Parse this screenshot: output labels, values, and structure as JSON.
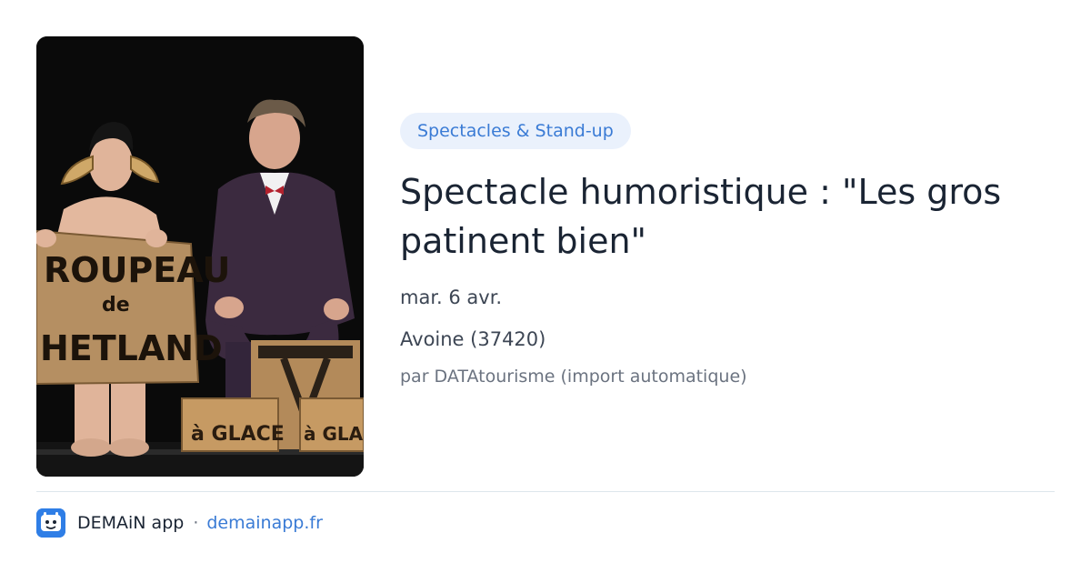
{
  "event": {
    "category": "Spectacles & Stand-up",
    "title": "Spectacle humoristique : \"Les gros patinent bien\"",
    "date": "mar. 6 avr.",
    "location": "Avoine (37420)",
    "source": "par DATAtourisme (import automatique)"
  },
  "image": {
    "sign_line1": "ROUPEAU",
    "sign_line2": "de",
    "sign_line3": "HETLAND",
    "box_left": "à GLACE",
    "box_right": "à GLACE"
  },
  "footer": {
    "app_name": "DEMAiN app",
    "separator": "·",
    "link": "demainapp.fr"
  },
  "colors": {
    "accent": "#3a7bd5",
    "badge_bg": "#eaf1fc",
    "title": "#1a2433",
    "logo": "#2f7ee6"
  },
  "icons": {
    "app_logo": "demain-logo-icon"
  }
}
